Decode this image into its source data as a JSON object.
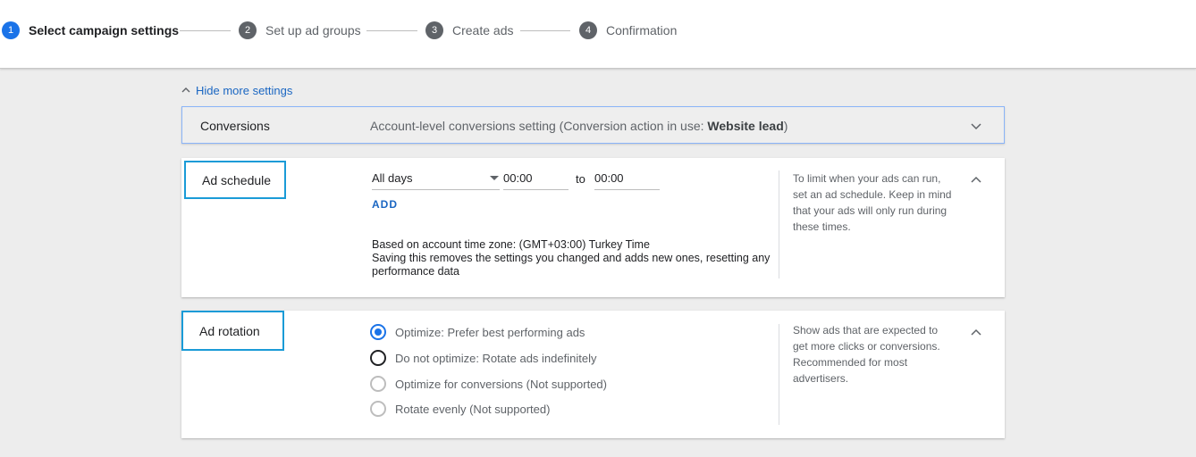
{
  "stepper": {
    "steps": [
      {
        "num": "1",
        "label": "Select campaign settings"
      },
      {
        "num": "2",
        "label": "Set up ad groups"
      },
      {
        "num": "3",
        "label": "Create ads"
      },
      {
        "num": "4",
        "label": "Confirmation"
      }
    ]
  },
  "settings": {
    "hide_label": "Hide more settings"
  },
  "conversions": {
    "title": "Conversions",
    "summary_prefix": "Account-level conversions setting (Conversion action in use: ",
    "summary_bold": "Website lead",
    "summary_suffix": ")"
  },
  "ad_schedule": {
    "title": "Ad schedule",
    "days_value": "All days",
    "start_time": "00:00",
    "to_label": "to",
    "end_time": "00:00",
    "add_label": "ADD",
    "timezone_note": "Based on account time zone: (GMT+03:00) Turkey Time",
    "warning_line1": "Saving this removes the settings you changed and adds new ones, resetting any",
    "warning_line2": "performance data",
    "help_text": "To limit when your ads can run, set an ad schedule. Keep in mind that your ads will only run during these times."
  },
  "ad_rotation": {
    "title": "Ad rotation",
    "options": [
      {
        "label": "Optimize: Prefer best performing ads",
        "state": "selected"
      },
      {
        "label": "Do not optimize: Rotate ads indefinitely",
        "state": "unselected"
      },
      {
        "label": "Optimize for conversions (Not supported)",
        "state": "disabled"
      },
      {
        "label": "Rotate evenly (Not supported)",
        "state": "disabled"
      }
    ],
    "help_text": "Show ads that are expected to get more clicks or conversions. Recommended for most advertisers."
  },
  "colors": {
    "accent": "#1a73e8",
    "link": "#1a66c2",
    "highlight_border": "#1a9bd7"
  }
}
